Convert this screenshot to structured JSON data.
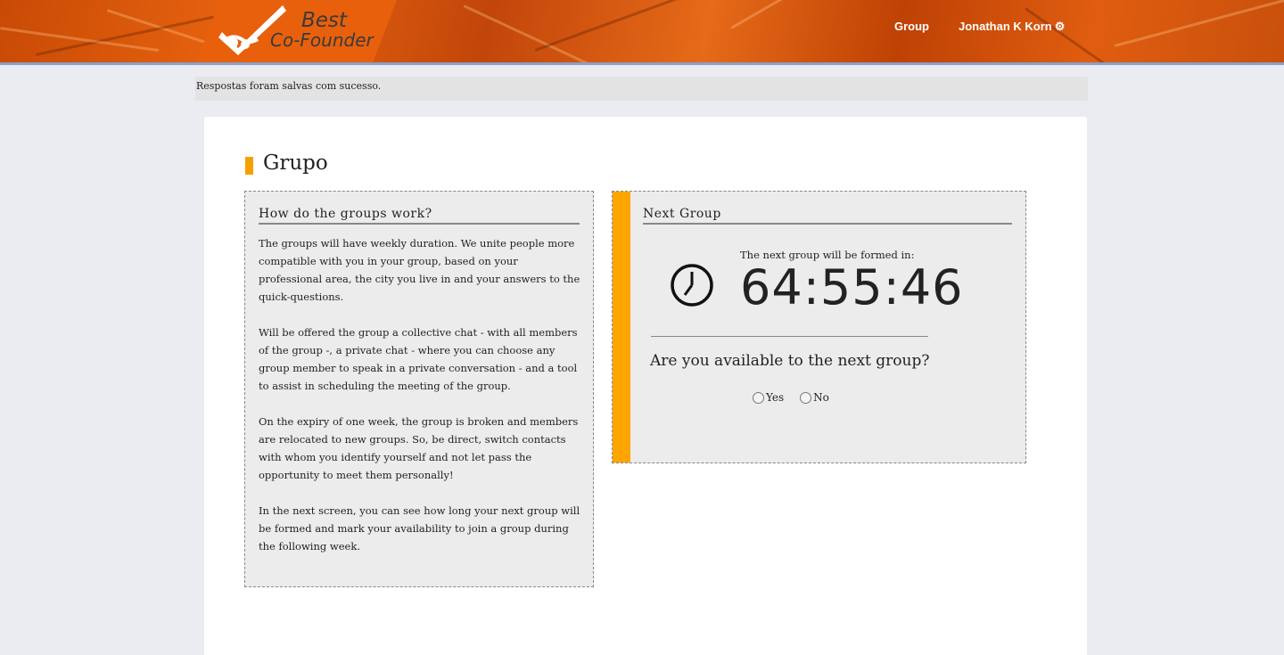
{
  "header": {
    "logo_line1": "Best",
    "logo_line2": "Co-Founder",
    "nav_group": "Group",
    "nav_user": "Jonathan K Korn",
    "user_menu_icon": "gear-icon",
    "logo_icon": "handshake-check-icon"
  },
  "flash": {
    "message": "Respostas foram salvas com sucesso."
  },
  "page": {
    "title": "Grupo",
    "accent_color": "#ffa500"
  },
  "how_it_works": {
    "heading": "How do the groups work?",
    "paragraphs": [
      "The groups will have weekly duration. We unite people more compatible with you in your group, based on your professional area, the city you live in and your answers to the quick-questions.",
      "Will be offered the group a collective chat - with all members of the group -, a private chat - where you can choose any group member to speak in a private conversation - and a tool to assist in scheduling the meeting of the group.",
      "On the expiry of one week, the group is broken and members are relocated to new groups. So, be direct, switch contacts with whom you identify yourself and not let pass the opportunity to meet them personally!",
      "In the next screen, you can see how long your next group will be formed and mark your availability to join a group during the following week."
    ]
  },
  "next_group": {
    "heading": "Next Group",
    "countdown_label": "The next group will be formed in:",
    "countdown": "64:55:46",
    "clock_icon": "clock-icon",
    "question": "Are you available to the next group?",
    "options": [
      "Yes",
      "No"
    ]
  },
  "colors": {
    "header_orange": "#e8650f",
    "accent": "#ffa500",
    "background": "#ebecf1"
  }
}
